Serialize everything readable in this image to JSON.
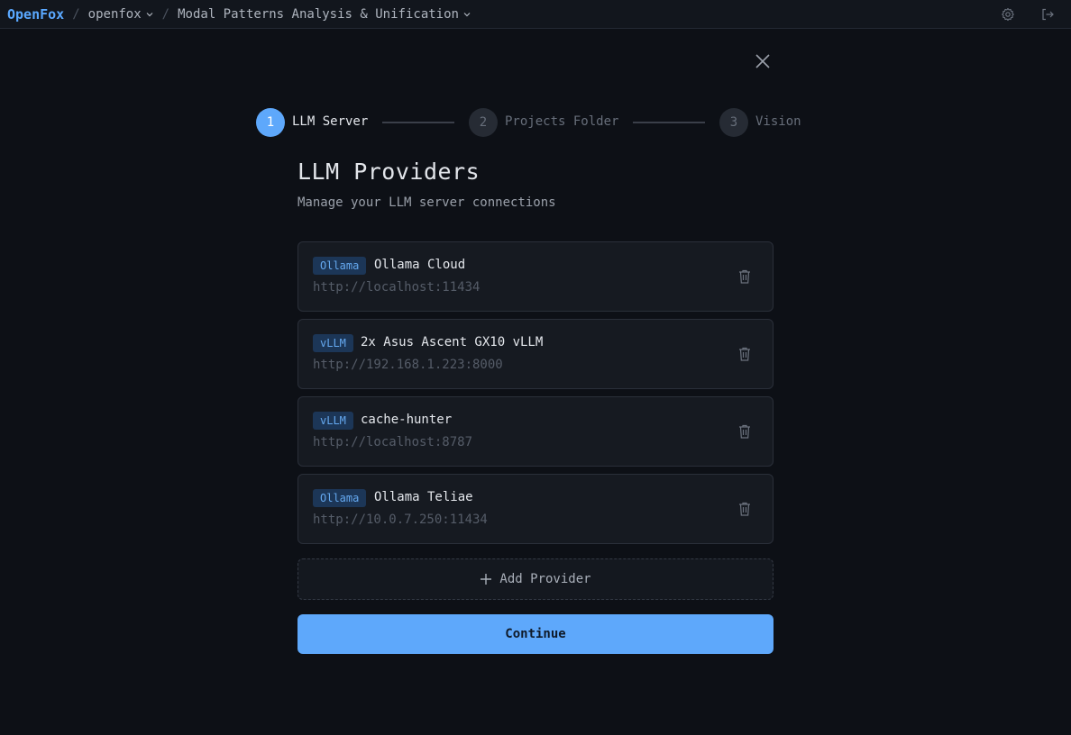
{
  "header": {
    "brand": "OpenFox",
    "project": "openfox",
    "session": "Modal Patterns Analysis & Unification",
    "separator": "/"
  },
  "stepper": {
    "steps": [
      {
        "number": "1",
        "label": "LLM Server",
        "state": "active"
      },
      {
        "number": "2",
        "label": "Projects Folder",
        "state": "inactive"
      },
      {
        "number": "3",
        "label": "Vision",
        "state": "inactive"
      }
    ]
  },
  "main": {
    "title": "LLM Providers",
    "subtitle": "Manage your LLM server connections",
    "providers": [
      {
        "type": "Ollama",
        "name": "Ollama Cloud",
        "url": "http://localhost:11434"
      },
      {
        "type": "vLLM",
        "name": "2x Asus Ascent GX10 vLLM",
        "url": "http://192.168.1.223:8000"
      },
      {
        "type": "vLLM",
        "name": "cache-hunter",
        "url": "http://localhost:8787"
      },
      {
        "type": "Ollama",
        "name": "Ollama Teliae",
        "url": "http://10.0.7.250:11434"
      }
    ],
    "add_label": "Add Provider",
    "continue_label": "Continue"
  },
  "colors": {
    "accent": "#5ea8fb",
    "background": "#0d1016",
    "badge_bg": "#1c3657"
  },
  "icons": [
    "chevron-down-icon",
    "gear-icon",
    "logout-icon",
    "close-icon",
    "trash-icon",
    "plus-icon"
  ]
}
